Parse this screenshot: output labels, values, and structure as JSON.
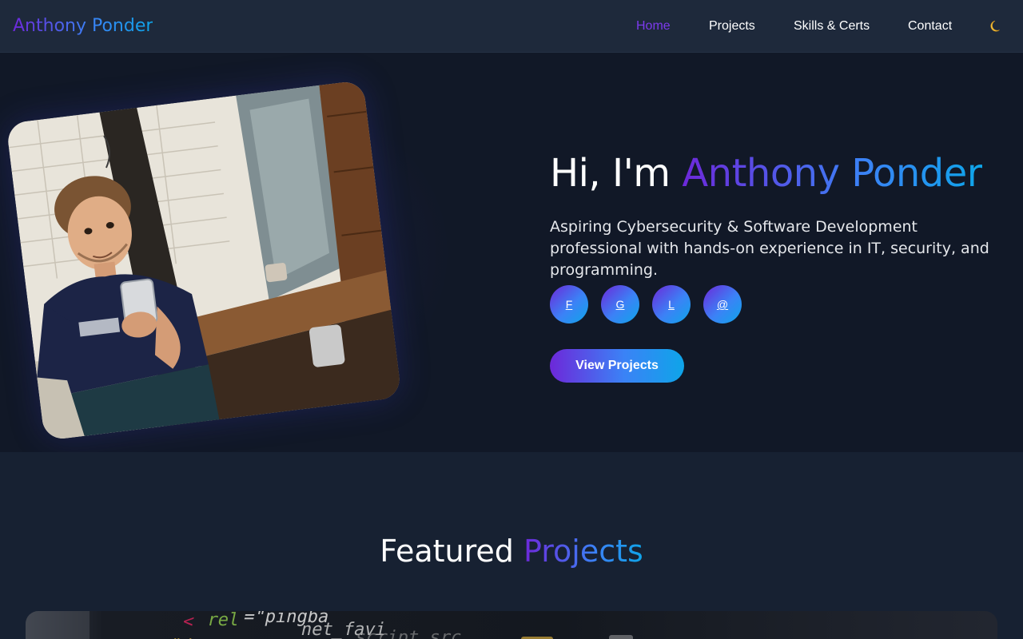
{
  "nav": {
    "brand": "Anthony Ponder",
    "links": [
      {
        "label": "Home",
        "active": true
      },
      {
        "label": "Projects",
        "active": false
      },
      {
        "label": "Skills & Certs",
        "active": false
      },
      {
        "label": "Contact",
        "active": false
      }
    ],
    "theme_icon": "moon-icon"
  },
  "hero": {
    "greeting": "Hi, I'm ",
    "name": "Anthony Ponder",
    "subtitle": "Aspiring Cybersecurity & Software Development professional with hands-on experience in IT, security, and programming.",
    "socials": [
      {
        "label": "F",
        "icon": "facebook-link"
      },
      {
        "label": "G",
        "icon": "github-link"
      },
      {
        "label": "L",
        "icon": "linkedin-link"
      },
      {
        "label": "@",
        "icon": "email-link"
      }
    ],
    "cta_label": "View Projects",
    "portrait_icon": "profile-portrait-illustration"
  },
  "featured": {
    "title_plain": "Featured ",
    "title_accent": "Projects"
  },
  "colors": {
    "accent_start": "#6d28d9",
    "accent_mid": "#3b82f6",
    "accent_end": "#0ea5e9",
    "nav_bg": "#1e293b",
    "hero_bg": "#111827",
    "section_bg": "#172132"
  }
}
